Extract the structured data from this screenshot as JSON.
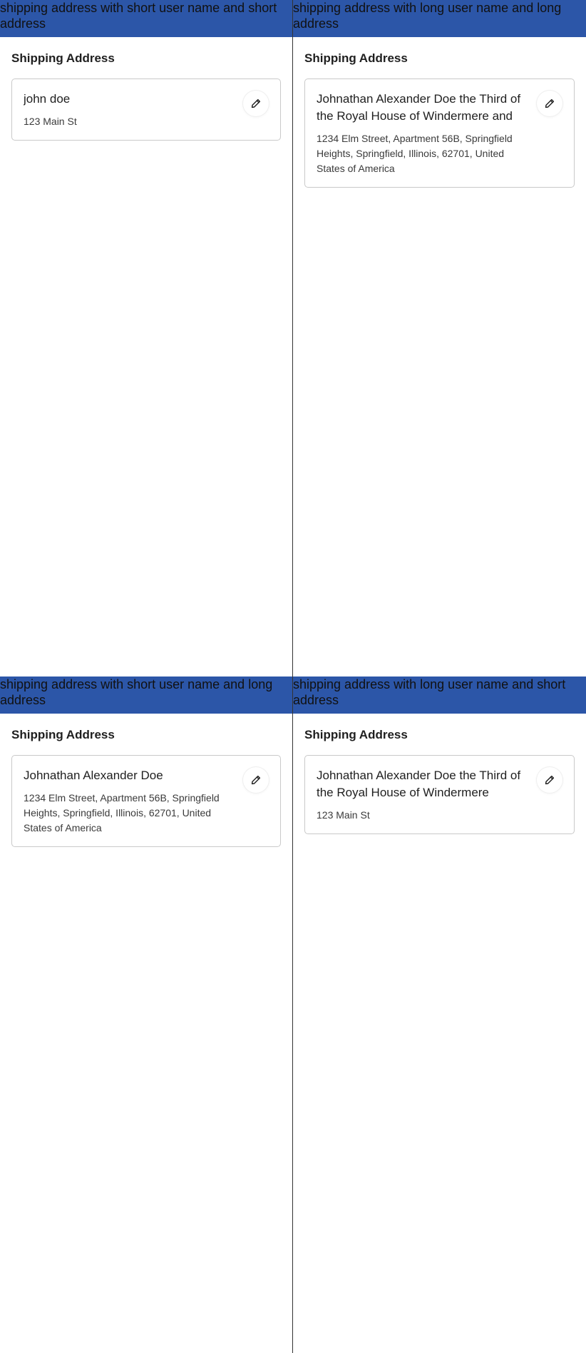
{
  "colors": {
    "banner_background": "#2c56a8",
    "card_border": "#c9c9c9",
    "divider": "#333333"
  },
  "stories": [
    {
      "banner": "shipping address with short user name and short address",
      "section_title": "Shipping Address",
      "name": "john doe",
      "address": "123 Main St",
      "edit_icon": "pencil-icon"
    },
    {
      "banner": "shipping address with long user name and long address",
      "section_title": "Shipping Address",
      "name": "Johnathan Alexander Doe the Third of the Royal House of Windermere and",
      "address": "1234 Elm Street, Apartment 56B, Springfield Heights, Springfield, Illinois, 62701, United States of America",
      "edit_icon": "pencil-icon"
    },
    {
      "banner": "shipping address with short user name and long address",
      "section_title": "Shipping Address",
      "name": "Johnathan Alexander Doe",
      "address": "1234 Elm Street, Apartment 56B, Springfield Heights, Springfield, Illinois, 62701, United States of America",
      "edit_icon": "pencil-icon"
    },
    {
      "banner": "shipping address with long user name and short address",
      "section_title": "Shipping Address",
      "name": "Johnathan Alexander Doe the Third of the Royal House of Windermere",
      "address": "123 Main St",
      "edit_icon": "pencil-icon"
    }
  ]
}
